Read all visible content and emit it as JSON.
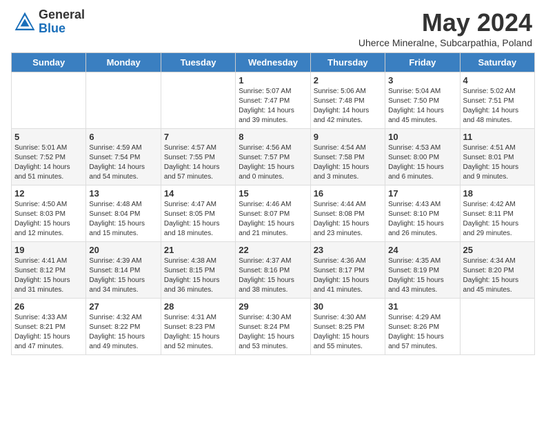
{
  "header": {
    "logo_general": "General",
    "logo_blue": "Blue",
    "month_title": "May 2024",
    "subtitle": "Uherce Mineralne, Subcarpathia, Poland"
  },
  "days_of_week": [
    "Sunday",
    "Monday",
    "Tuesday",
    "Wednesday",
    "Thursday",
    "Friday",
    "Saturday"
  ],
  "weeks": [
    [
      {
        "day": "",
        "info": ""
      },
      {
        "day": "",
        "info": ""
      },
      {
        "day": "",
        "info": ""
      },
      {
        "day": "1",
        "info": "Sunrise: 5:07 AM\nSunset: 7:47 PM\nDaylight: 14 hours\nand 39 minutes."
      },
      {
        "day": "2",
        "info": "Sunrise: 5:06 AM\nSunset: 7:48 PM\nDaylight: 14 hours\nand 42 minutes."
      },
      {
        "day": "3",
        "info": "Sunrise: 5:04 AM\nSunset: 7:50 PM\nDaylight: 14 hours\nand 45 minutes."
      },
      {
        "day": "4",
        "info": "Sunrise: 5:02 AM\nSunset: 7:51 PM\nDaylight: 14 hours\nand 48 minutes."
      }
    ],
    [
      {
        "day": "5",
        "info": "Sunrise: 5:01 AM\nSunset: 7:52 PM\nDaylight: 14 hours\nand 51 minutes."
      },
      {
        "day": "6",
        "info": "Sunrise: 4:59 AM\nSunset: 7:54 PM\nDaylight: 14 hours\nand 54 minutes."
      },
      {
        "day": "7",
        "info": "Sunrise: 4:57 AM\nSunset: 7:55 PM\nDaylight: 14 hours\nand 57 minutes."
      },
      {
        "day": "8",
        "info": "Sunrise: 4:56 AM\nSunset: 7:57 PM\nDaylight: 15 hours\nand 0 minutes."
      },
      {
        "day": "9",
        "info": "Sunrise: 4:54 AM\nSunset: 7:58 PM\nDaylight: 15 hours\nand 3 minutes."
      },
      {
        "day": "10",
        "info": "Sunrise: 4:53 AM\nSunset: 8:00 PM\nDaylight: 15 hours\nand 6 minutes."
      },
      {
        "day": "11",
        "info": "Sunrise: 4:51 AM\nSunset: 8:01 PM\nDaylight: 15 hours\nand 9 minutes."
      }
    ],
    [
      {
        "day": "12",
        "info": "Sunrise: 4:50 AM\nSunset: 8:03 PM\nDaylight: 15 hours\nand 12 minutes."
      },
      {
        "day": "13",
        "info": "Sunrise: 4:48 AM\nSunset: 8:04 PM\nDaylight: 15 hours\nand 15 minutes."
      },
      {
        "day": "14",
        "info": "Sunrise: 4:47 AM\nSunset: 8:05 PM\nDaylight: 15 hours\nand 18 minutes."
      },
      {
        "day": "15",
        "info": "Sunrise: 4:46 AM\nSunset: 8:07 PM\nDaylight: 15 hours\nand 21 minutes."
      },
      {
        "day": "16",
        "info": "Sunrise: 4:44 AM\nSunset: 8:08 PM\nDaylight: 15 hours\nand 23 minutes."
      },
      {
        "day": "17",
        "info": "Sunrise: 4:43 AM\nSunset: 8:10 PM\nDaylight: 15 hours\nand 26 minutes."
      },
      {
        "day": "18",
        "info": "Sunrise: 4:42 AM\nSunset: 8:11 PM\nDaylight: 15 hours\nand 29 minutes."
      }
    ],
    [
      {
        "day": "19",
        "info": "Sunrise: 4:41 AM\nSunset: 8:12 PM\nDaylight: 15 hours\nand 31 minutes."
      },
      {
        "day": "20",
        "info": "Sunrise: 4:39 AM\nSunset: 8:14 PM\nDaylight: 15 hours\nand 34 minutes."
      },
      {
        "day": "21",
        "info": "Sunrise: 4:38 AM\nSunset: 8:15 PM\nDaylight: 15 hours\nand 36 minutes."
      },
      {
        "day": "22",
        "info": "Sunrise: 4:37 AM\nSunset: 8:16 PM\nDaylight: 15 hours\nand 38 minutes."
      },
      {
        "day": "23",
        "info": "Sunrise: 4:36 AM\nSunset: 8:17 PM\nDaylight: 15 hours\nand 41 minutes."
      },
      {
        "day": "24",
        "info": "Sunrise: 4:35 AM\nSunset: 8:19 PM\nDaylight: 15 hours\nand 43 minutes."
      },
      {
        "day": "25",
        "info": "Sunrise: 4:34 AM\nSunset: 8:20 PM\nDaylight: 15 hours\nand 45 minutes."
      }
    ],
    [
      {
        "day": "26",
        "info": "Sunrise: 4:33 AM\nSunset: 8:21 PM\nDaylight: 15 hours\nand 47 minutes."
      },
      {
        "day": "27",
        "info": "Sunrise: 4:32 AM\nSunset: 8:22 PM\nDaylight: 15 hours\nand 49 minutes."
      },
      {
        "day": "28",
        "info": "Sunrise: 4:31 AM\nSunset: 8:23 PM\nDaylight: 15 hours\nand 52 minutes."
      },
      {
        "day": "29",
        "info": "Sunrise: 4:30 AM\nSunset: 8:24 PM\nDaylight: 15 hours\nand 53 minutes."
      },
      {
        "day": "30",
        "info": "Sunrise: 4:30 AM\nSunset: 8:25 PM\nDaylight: 15 hours\nand 55 minutes."
      },
      {
        "day": "31",
        "info": "Sunrise: 4:29 AM\nSunset: 8:26 PM\nDaylight: 15 hours\nand 57 minutes."
      },
      {
        "day": "",
        "info": ""
      }
    ]
  ]
}
